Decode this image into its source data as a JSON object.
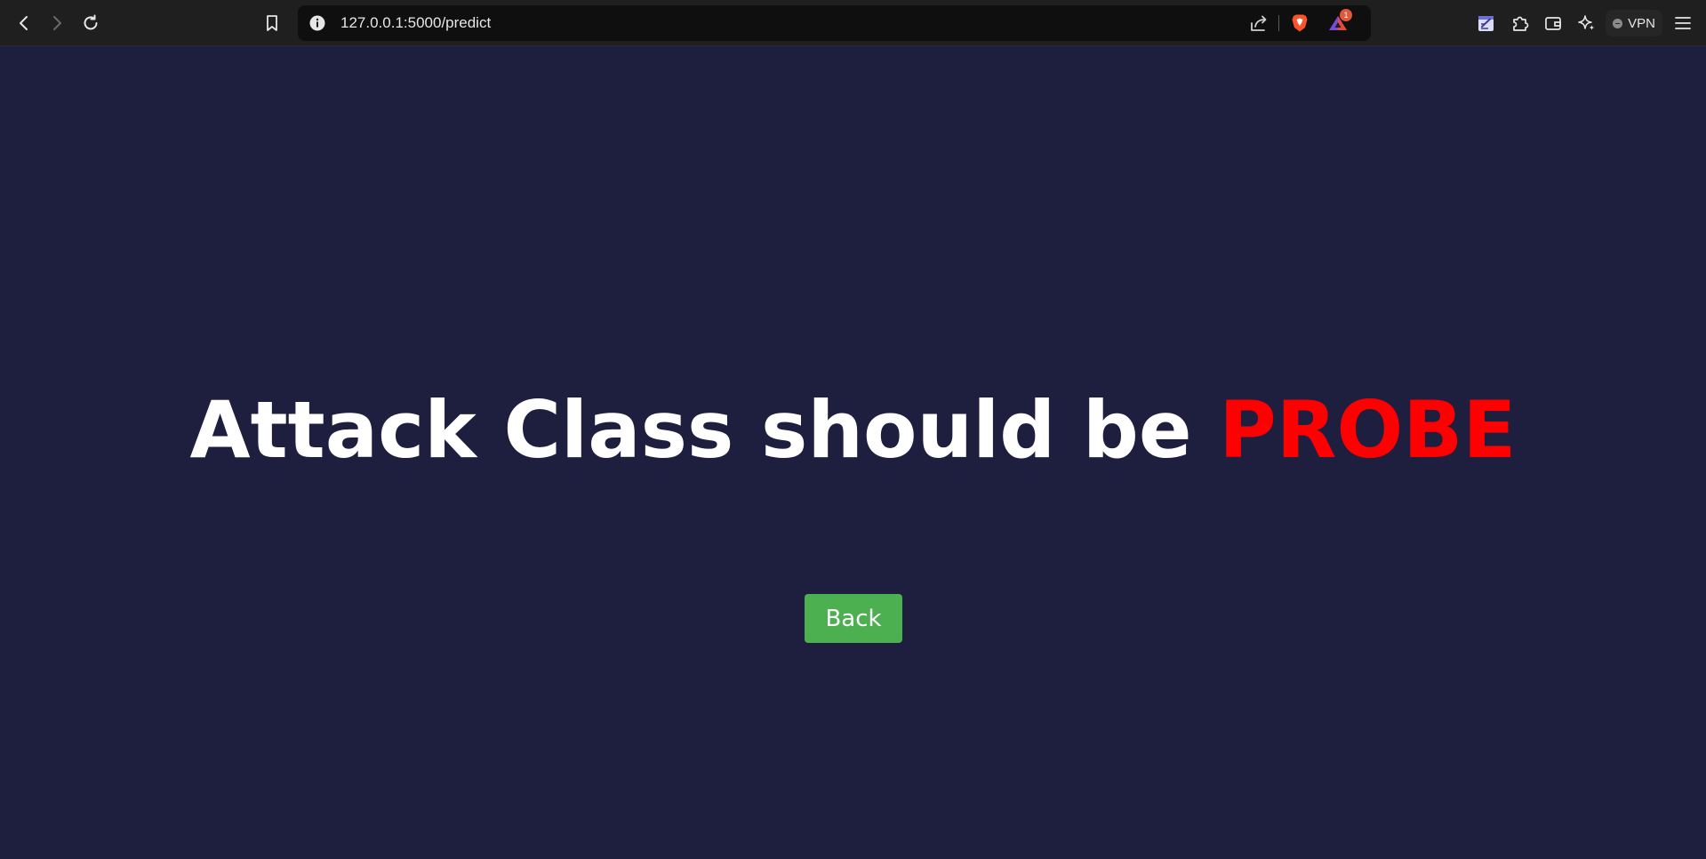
{
  "browser": {
    "url": "127.0.0.1:5000/predict",
    "notification_count": "1",
    "vpn_label": "VPN",
    "icons": [
      "back-icon",
      "forward-icon",
      "reload-icon",
      "bookmark-icon",
      "info-icon",
      "share-icon",
      "brave-shields-icon",
      "brave-rewards-icon",
      "leo-notes-icon",
      "extensions-icon",
      "wallet-icon",
      "leo-ai-icon",
      "vpn-icon",
      "menu-icon"
    ]
  },
  "page": {
    "headline_prefix": "Attack Class should be ",
    "result": "PROBE",
    "back_label": "Back",
    "colors": {
      "background": "#1e1f3f",
      "headline": "#ffffff",
      "result": "#ff0000",
      "button": "#4caf50"
    }
  }
}
